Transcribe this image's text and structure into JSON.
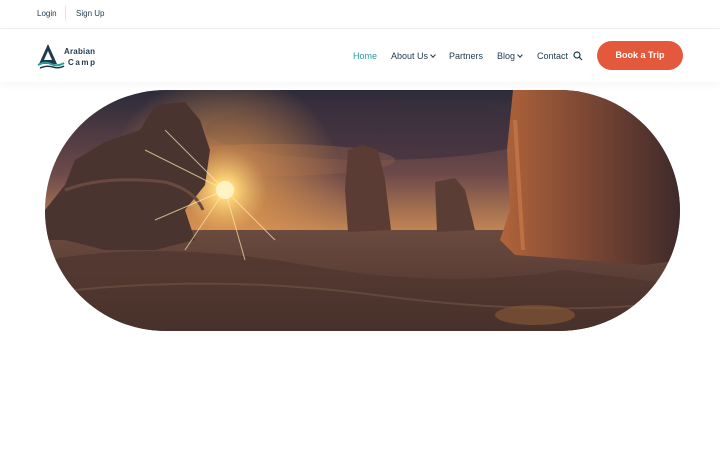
{
  "topbar": {
    "login": "Login",
    "signup": "Sign Up"
  },
  "brand": {
    "line1": "Arabian",
    "line2": "Camp",
    "color": "#1f3a4d"
  },
  "nav": {
    "home": "Home",
    "about": "About Us",
    "partners": "Partners",
    "blog": "Blog",
    "contact": "Contact"
  },
  "cta": {
    "label": "Book a Trip",
    "color": "#e4593b"
  },
  "icons": {
    "search": "search-icon",
    "chevron": "chevron-down-icon"
  },
  "colors": {
    "accent": "#2a9d9a",
    "text": "#1f3a4d"
  }
}
